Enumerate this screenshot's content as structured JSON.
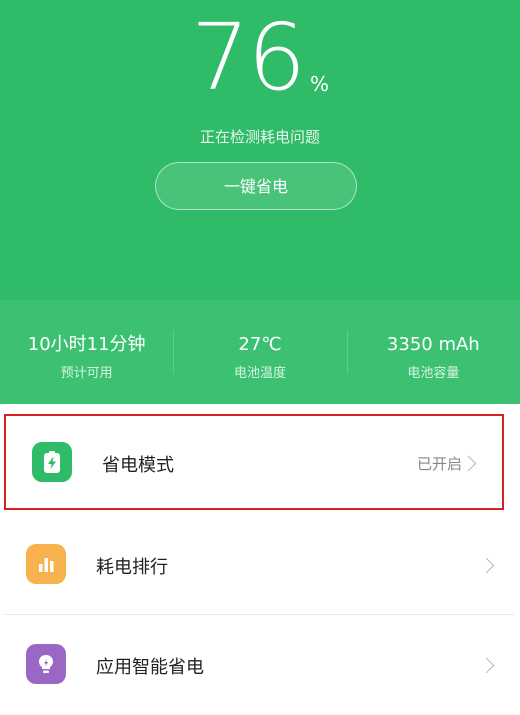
{
  "battery": {
    "percent": "76",
    "percent_unit": "%",
    "status": "正在检测耗电问题",
    "optimize_label": "一键省电"
  },
  "stats": [
    {
      "value": "10小时11分钟",
      "label": "预计可用"
    },
    {
      "value": "27℃",
      "label": "电池温度"
    },
    {
      "value": "3350 mAh",
      "label": "电池容量"
    }
  ],
  "menu": [
    {
      "label": "省电模式",
      "status": "已开启",
      "icon": "battery-bolt-icon",
      "icon_color": "#2fbb68"
    },
    {
      "label": "耗电排行",
      "status": "",
      "icon": "bar-chart-icon",
      "icon_color": "#f7b24d"
    },
    {
      "label": "应用智能省电",
      "status": "",
      "icon": "lightbulb-icon",
      "icon_color": "#9a67c4"
    }
  ],
  "colors": {
    "hero_green": "#2fbb68",
    "stats_green": "#3cc172",
    "highlight_border": "#d92020"
  }
}
